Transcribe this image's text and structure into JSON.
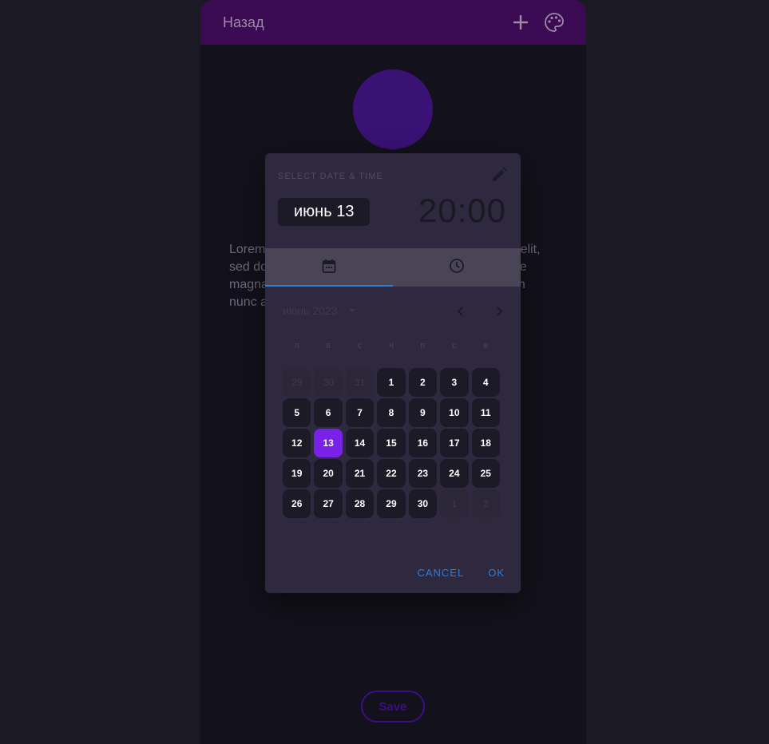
{
  "appbar": {
    "title": "Назад",
    "add_icon": "plus-icon",
    "palette_icon": "palette-icon"
  },
  "content": {
    "lorem": "Lorem ipsum dolor sit amet, consectetur adipiscing elit, sed do eiusmod tempor incididunt ut labore et dolore magna aliqua. Ut enim ad minim veniam, quis ipsum nunc a"
  },
  "save_label": "Save",
  "dialog": {
    "label": "SELECT DATE & TIME",
    "date_chip": "июнь 13",
    "time": {
      "hours": "20",
      "separator": ":",
      "minutes": "00"
    },
    "month_label": "июнь 2023",
    "weekdays": [
      "п",
      "в",
      "с",
      "ч",
      "п",
      "с",
      "в"
    ],
    "weeks": [
      [
        {
          "d": "29",
          "out": true
        },
        {
          "d": "30",
          "out": true
        },
        {
          "d": "31",
          "out": true
        },
        {
          "d": "1"
        },
        {
          "d": "2"
        },
        {
          "d": "3"
        },
        {
          "d": "4"
        }
      ],
      [
        {
          "d": "5"
        },
        {
          "d": "6"
        },
        {
          "d": "7"
        },
        {
          "d": "8"
        },
        {
          "d": "9"
        },
        {
          "d": "10"
        },
        {
          "d": "11"
        }
      ],
      [
        {
          "d": "12"
        },
        {
          "d": "13",
          "selected": true
        },
        {
          "d": "14"
        },
        {
          "d": "15"
        },
        {
          "d": "16"
        },
        {
          "d": "17"
        },
        {
          "d": "18"
        }
      ],
      [
        {
          "d": "19"
        },
        {
          "d": "20"
        },
        {
          "d": "21"
        },
        {
          "d": "22"
        },
        {
          "d": "23"
        },
        {
          "d": "24"
        },
        {
          "d": "25"
        }
      ],
      [
        {
          "d": "26"
        },
        {
          "d": "27"
        },
        {
          "d": "28"
        },
        {
          "d": "29"
        },
        {
          "d": "30"
        },
        {
          "d": "1",
          "out": true
        },
        {
          "d": "2",
          "out": true
        }
      ]
    ],
    "cancel_label": "CANCEL",
    "ok_label": "OK"
  },
  "colors": {
    "accent": "#7722e6",
    "link": "#2f7bd6",
    "appbar": "#3a0a52"
  }
}
